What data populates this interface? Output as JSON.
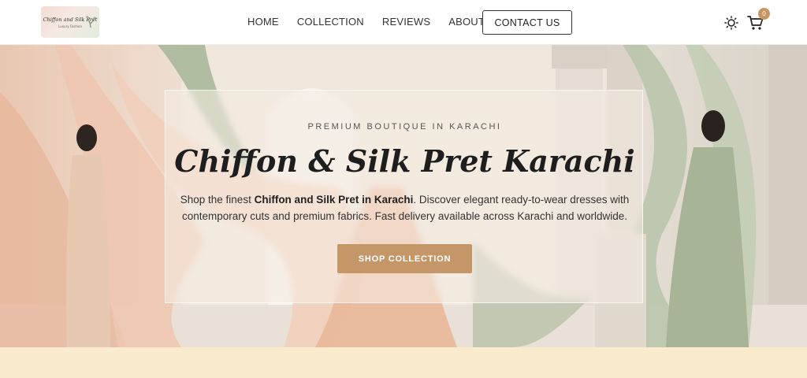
{
  "header": {
    "logo": {
      "title": "Chiffon and Silk Pret",
      "subtitle": "Luxury Fashion"
    },
    "nav": [
      "HOME",
      "COLLECTION",
      "REVIEWS",
      "ABOUT"
    ],
    "contact_label": "CONTACT US",
    "cart_count": "0",
    "icons": {
      "theme": "sun-icon",
      "cart": "cart-icon"
    }
  },
  "hero": {
    "eyebrow": "PREMIUM BOUTIQUE IN KARACHI",
    "title": "Chiffon & Silk Pret Karachi",
    "desc_prefix": "Shop the finest ",
    "desc_bold": "Chiffon and Silk Pret in Karachi",
    "desc_suffix": ". Discover elegant ready-to-wear dresses with contemporary cuts and premium fabrics. Fast delivery available across Karachi and worldwide.",
    "cta_label": "SHOP COLLECTION"
  },
  "colors": {
    "accent": "#c59668",
    "badge": "#c8955e",
    "strip": "#fbebcd"
  }
}
